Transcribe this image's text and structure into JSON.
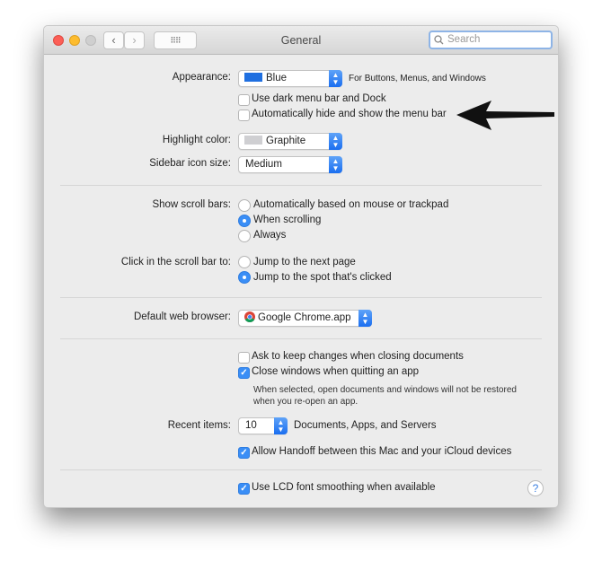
{
  "window": {
    "title": "General",
    "search_placeholder": "Search"
  },
  "appearance": {
    "label": "Appearance:",
    "value": "Blue",
    "hint": "For Buttons, Menus, and Windows",
    "swatch": "#1f6fe0"
  },
  "dark_menu": {
    "label": "Use dark menu bar and Dock",
    "checked": false
  },
  "auto_hide": {
    "label": "Automatically hide and show the menu bar",
    "checked": false
  },
  "highlight": {
    "label": "Highlight color:",
    "value": "Graphite",
    "swatch": "#cfcfd2"
  },
  "sidebar_size": {
    "label": "Sidebar icon size:",
    "value": "Medium"
  },
  "scroll_bars": {
    "label": "Show scroll bars:",
    "options": [
      "Automatically based on mouse or trackpad",
      "When scrolling",
      "Always"
    ],
    "selected": 1
  },
  "click_scroll": {
    "label": "Click in the scroll bar to:",
    "options": [
      "Jump to the next page",
      "Jump to the spot that's clicked"
    ],
    "selected": 1
  },
  "browser": {
    "label": "Default web browser:",
    "value": "Google Chrome.app"
  },
  "ask_keep": {
    "label": "Ask to keep changes when closing documents",
    "checked": false
  },
  "close_windows": {
    "label": "Close windows when quitting an app",
    "checked": true,
    "note1": "When selected, open documents and windows will not be restored",
    "note2": "when you re-open an app."
  },
  "recent": {
    "label": "Recent items:",
    "value": "10",
    "suffix": "Documents, Apps, and Servers"
  },
  "handoff": {
    "label": "Allow Handoff between this Mac and your iCloud devices",
    "checked": true
  },
  "lcd": {
    "label": "Use LCD font smoothing when available",
    "checked": true
  },
  "help": "?"
}
